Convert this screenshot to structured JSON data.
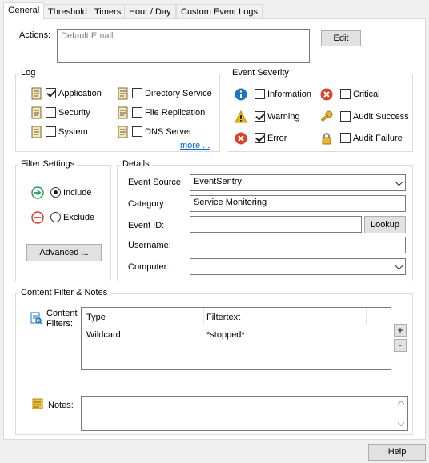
{
  "tabs": [
    "General",
    "Threshold",
    "Timers",
    "Hour / Day",
    "Custom Event Logs"
  ],
  "actions": {
    "label": "Actions:",
    "placeholder": "Default Email",
    "edit_label": "Edit"
  },
  "log": {
    "title": "Log",
    "items": [
      {
        "label": "Application",
        "checked": true
      },
      {
        "label": "Security",
        "checked": false
      },
      {
        "label": "System",
        "checked": false
      },
      {
        "label": "Directory Service",
        "checked": false
      },
      {
        "label": "File Replication",
        "checked": false
      },
      {
        "label": "DNS Server",
        "checked": false
      }
    ],
    "more_label": "more ..."
  },
  "severity": {
    "title": "Event Severity",
    "items": [
      {
        "label": "Information",
        "checked": false,
        "icon": "info-icon"
      },
      {
        "label": "Warning",
        "checked": true,
        "icon": "warning-icon"
      },
      {
        "label": "Error",
        "checked": true,
        "icon": "error-icon"
      },
      {
        "label": "Critical",
        "checked": false,
        "icon": "critical-icon"
      },
      {
        "label": "Audit Success",
        "checked": false,
        "icon": "key-icon"
      },
      {
        "label": "Audit Failure",
        "checked": false,
        "icon": "lock-icon"
      }
    ]
  },
  "filter_settings": {
    "title": "Filter Settings",
    "include_label": "Include",
    "exclude_label": "Exclude",
    "selected": "Include",
    "advanced_label": "Advanced ..."
  },
  "details": {
    "title": "Details",
    "event_source_label": "Event Source:",
    "event_source_value": "EventSentry",
    "category_label": "Category:",
    "category_value": "Service Monitoring",
    "event_id_label": "Event ID:",
    "event_id_value": "",
    "lookup_label": "Lookup",
    "username_label": "Username:",
    "username_value": "",
    "computer_label": "Computer:",
    "computer_value": ""
  },
  "content_filter": {
    "title": "Content Filter & Notes",
    "filters_label_1": "Content",
    "filters_label_2": "Filters:",
    "columns": [
      "Type",
      "Filtertext"
    ],
    "rows": [
      {
        "type": "Wildcard",
        "filtertext": "*stopped*"
      }
    ],
    "add_label": "+",
    "remove_label": "-",
    "notes_label": "Notes:",
    "notes_value": ""
  },
  "help_label": "Help",
  "colors": {
    "accent_blue": "#1e73be",
    "error_red": "#d9412d",
    "include_green": "#2e9e5b",
    "warning_yellow": "#f2b705",
    "link": "#0066cc"
  }
}
